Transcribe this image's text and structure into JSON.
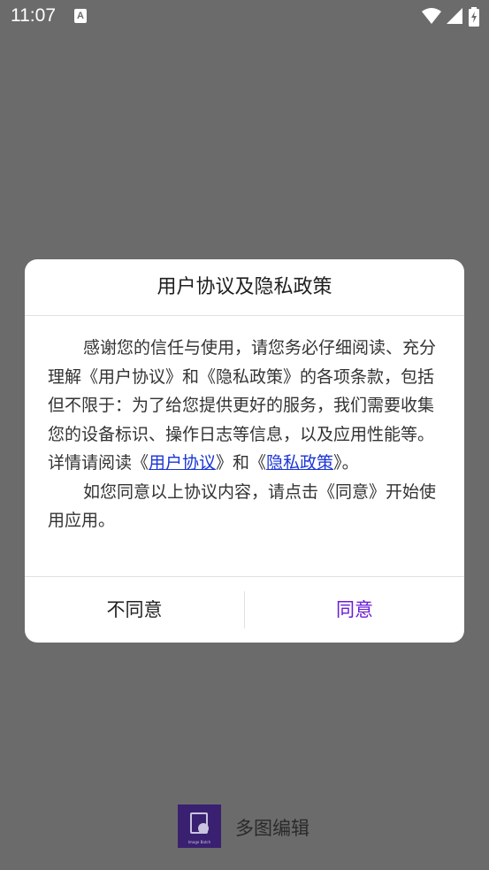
{
  "status_bar": {
    "time": "11:07",
    "icons": [
      "notification-a-icon",
      "wifi-icon",
      "signal-icon",
      "battery-charging-icon"
    ]
  },
  "dialog": {
    "title": "用户协议及隐私政策",
    "body": {
      "p1_pre": "感谢您的信任与使用，请您务必仔细阅读、充分理解《用户协议》和《隐私政策》的各项条款，包括但不限于：为了给您提供更好的服务，我们需要收集您的设备标识、操作日志等信息，以及应用性能等。详情请阅读《",
      "link_user_agreement": "用户协议",
      "p1_mid": "》和《",
      "link_privacy_policy": "隐私政策",
      "p1_post": "》。",
      "p2": "如您同意以上协议内容，请点击《同意》开始使用应用。"
    },
    "buttons": {
      "disagree": "不同意",
      "agree": "同意"
    }
  },
  "splash": {
    "logo_caption": "Image Batch",
    "app_name": "多图编辑"
  },
  "colors": {
    "background_scrim": "#6b6b6b",
    "agree_accent": "#6a1bd6",
    "link": "#1a35d6"
  }
}
